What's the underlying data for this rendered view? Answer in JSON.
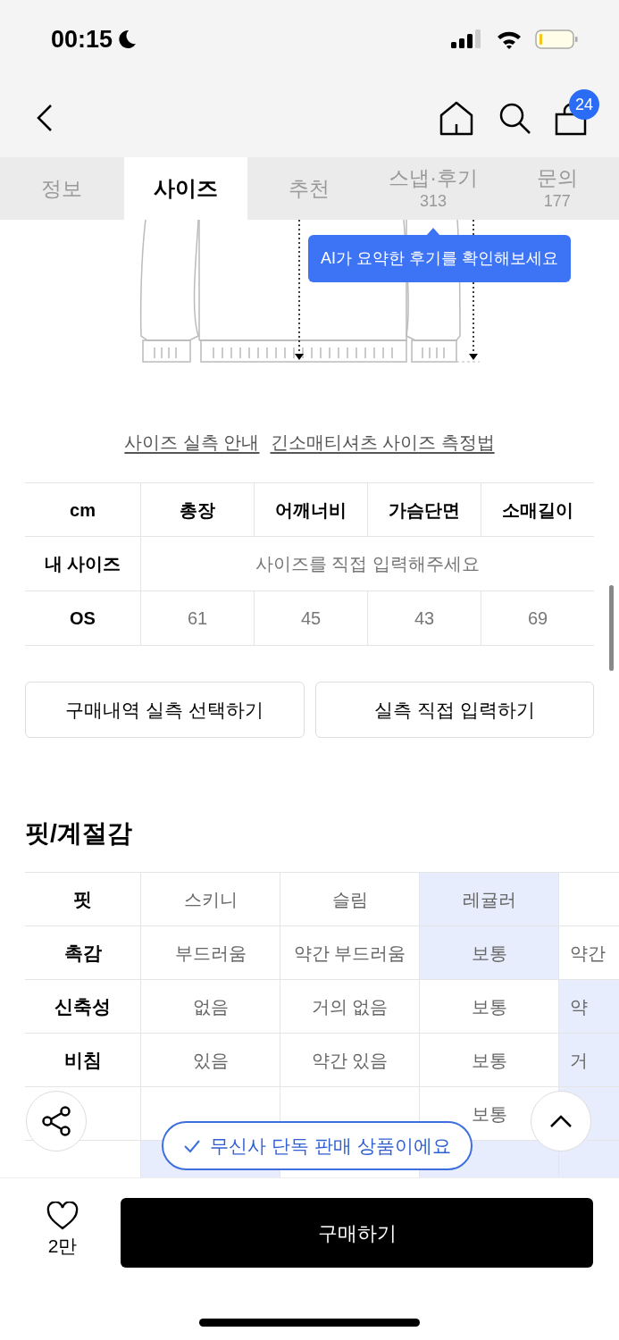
{
  "status_bar": {
    "time": "00:15"
  },
  "nav": {
    "cart_count": "24"
  },
  "tabs": [
    {
      "label": "정보",
      "selected": false
    },
    {
      "label": "사이즈",
      "selected": true
    },
    {
      "label": "추천",
      "selected": false
    },
    {
      "label": "스냅·후기",
      "count": "313",
      "selected": false
    },
    {
      "label": "문의",
      "count": "177",
      "selected": false
    }
  ],
  "tooltip": "AI가 요약한 후기를 확인해보세요",
  "links": [
    "사이즈 실측 안내",
    "긴소매티셔츠 사이즈 측정법"
  ],
  "size_table": {
    "columns": [
      "cm",
      "총장",
      "어깨너비",
      "가슴단면",
      "소매길이"
    ],
    "rows": [
      {
        "label": "내 사이즈",
        "kind": "prompt",
        "text": "사이즈를 직접 입력해주세요"
      },
      {
        "label": "OS",
        "kind": "values",
        "values": [
          "61",
          "45",
          "43",
          "69"
        ]
      }
    ]
  },
  "size_buttons": [
    "구매내역 실측 선택하기",
    "실측 직접 입력하기"
  ],
  "fit_section": {
    "title": "핏/계절감",
    "rows": [
      {
        "label": "핏",
        "cells": [
          {
            "text": "스키니",
            "selected": false
          },
          {
            "text": "슬림",
            "selected": false
          },
          {
            "text": "레귤러",
            "selected": true
          },
          {
            "selected": false
          }
        ]
      },
      {
        "label": "촉감",
        "cells": [
          {
            "text": "부드러움",
            "selected": false
          },
          {
            "text": "약간 부드러움",
            "selected": false
          },
          {
            "text": "보통",
            "selected": true
          },
          {
            "text": "약간",
            "selected": false
          }
        ]
      },
      {
        "label": "신축성",
        "cells": [
          {
            "text": "없음",
            "selected": false
          },
          {
            "text": "거의 없음",
            "selected": false
          },
          {
            "text": "보통",
            "selected": false
          },
          {
            "text": "약",
            "selected": true
          }
        ]
      },
      {
        "label": "비침",
        "cells": [
          {
            "text": "있음",
            "selected": false
          },
          {
            "text": "약간 있음",
            "selected": false
          },
          {
            "text": "보통",
            "selected": false
          },
          {
            "text": "거",
            "selected": true
          }
        ]
      },
      {
        "cells": [
          {
            "selected": false
          },
          {
            "selected": false
          },
          {
            "text": "보통",
            "selected": false
          },
          {
            "selected": true
          }
        ]
      },
      {
        "cells": [
          {
            "selected": true
          },
          {
            "selected": false
          },
          {
            "selected": true
          },
          {
            "selected": true
          }
        ]
      }
    ]
  },
  "exclusive_badge": "무신사 단독 판매 상품이에요",
  "bottom_bar": {
    "likes": "2만",
    "buy_button": "구매하기"
  }
}
